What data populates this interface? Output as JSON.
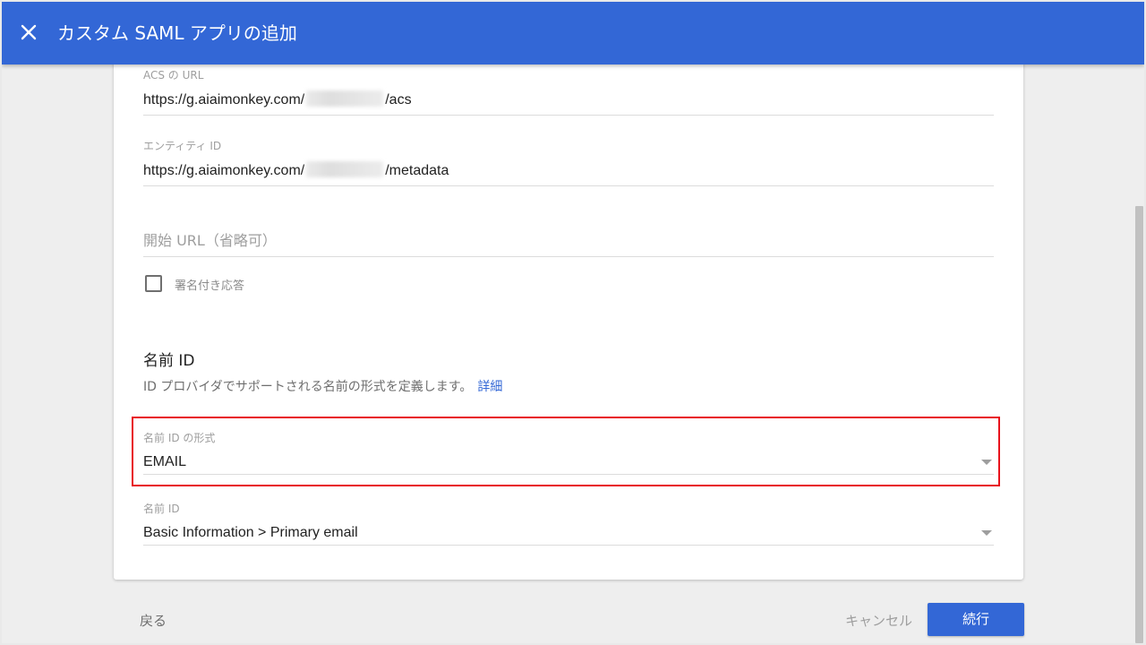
{
  "header": {
    "title": "カスタム SAML アプリの追加",
    "close_icon": "close-icon",
    "color": "#3367d6"
  },
  "form": {
    "acs_url": {
      "label": "ACS の URL",
      "value_prefix": "https://g.aiaimonkey.com/",
      "value_suffix": "/acs"
    },
    "entity_id": {
      "label": "エンティティ ID",
      "value_prefix": "https://g.aiaimonkey.com/",
      "value_suffix": "/metadata"
    },
    "start_url": {
      "placeholder": "開始 URL（省略可）"
    },
    "signed_response": {
      "label": "署名付き応答",
      "checked": false
    },
    "name_id_section": {
      "title": "名前 ID",
      "description": "ID プロバイダでサポートされる名前の形式を定義します。",
      "details_link": "詳細"
    },
    "name_id_format": {
      "label": "名前 ID の形式",
      "value": "EMAIL"
    },
    "name_id": {
      "label": "名前 ID",
      "value": "Basic Information > Primary email"
    }
  },
  "footer": {
    "back_label": "戻る",
    "cancel_label": "キャンセル",
    "continue_label": "続行"
  },
  "highlight_color": "#e8101c"
}
